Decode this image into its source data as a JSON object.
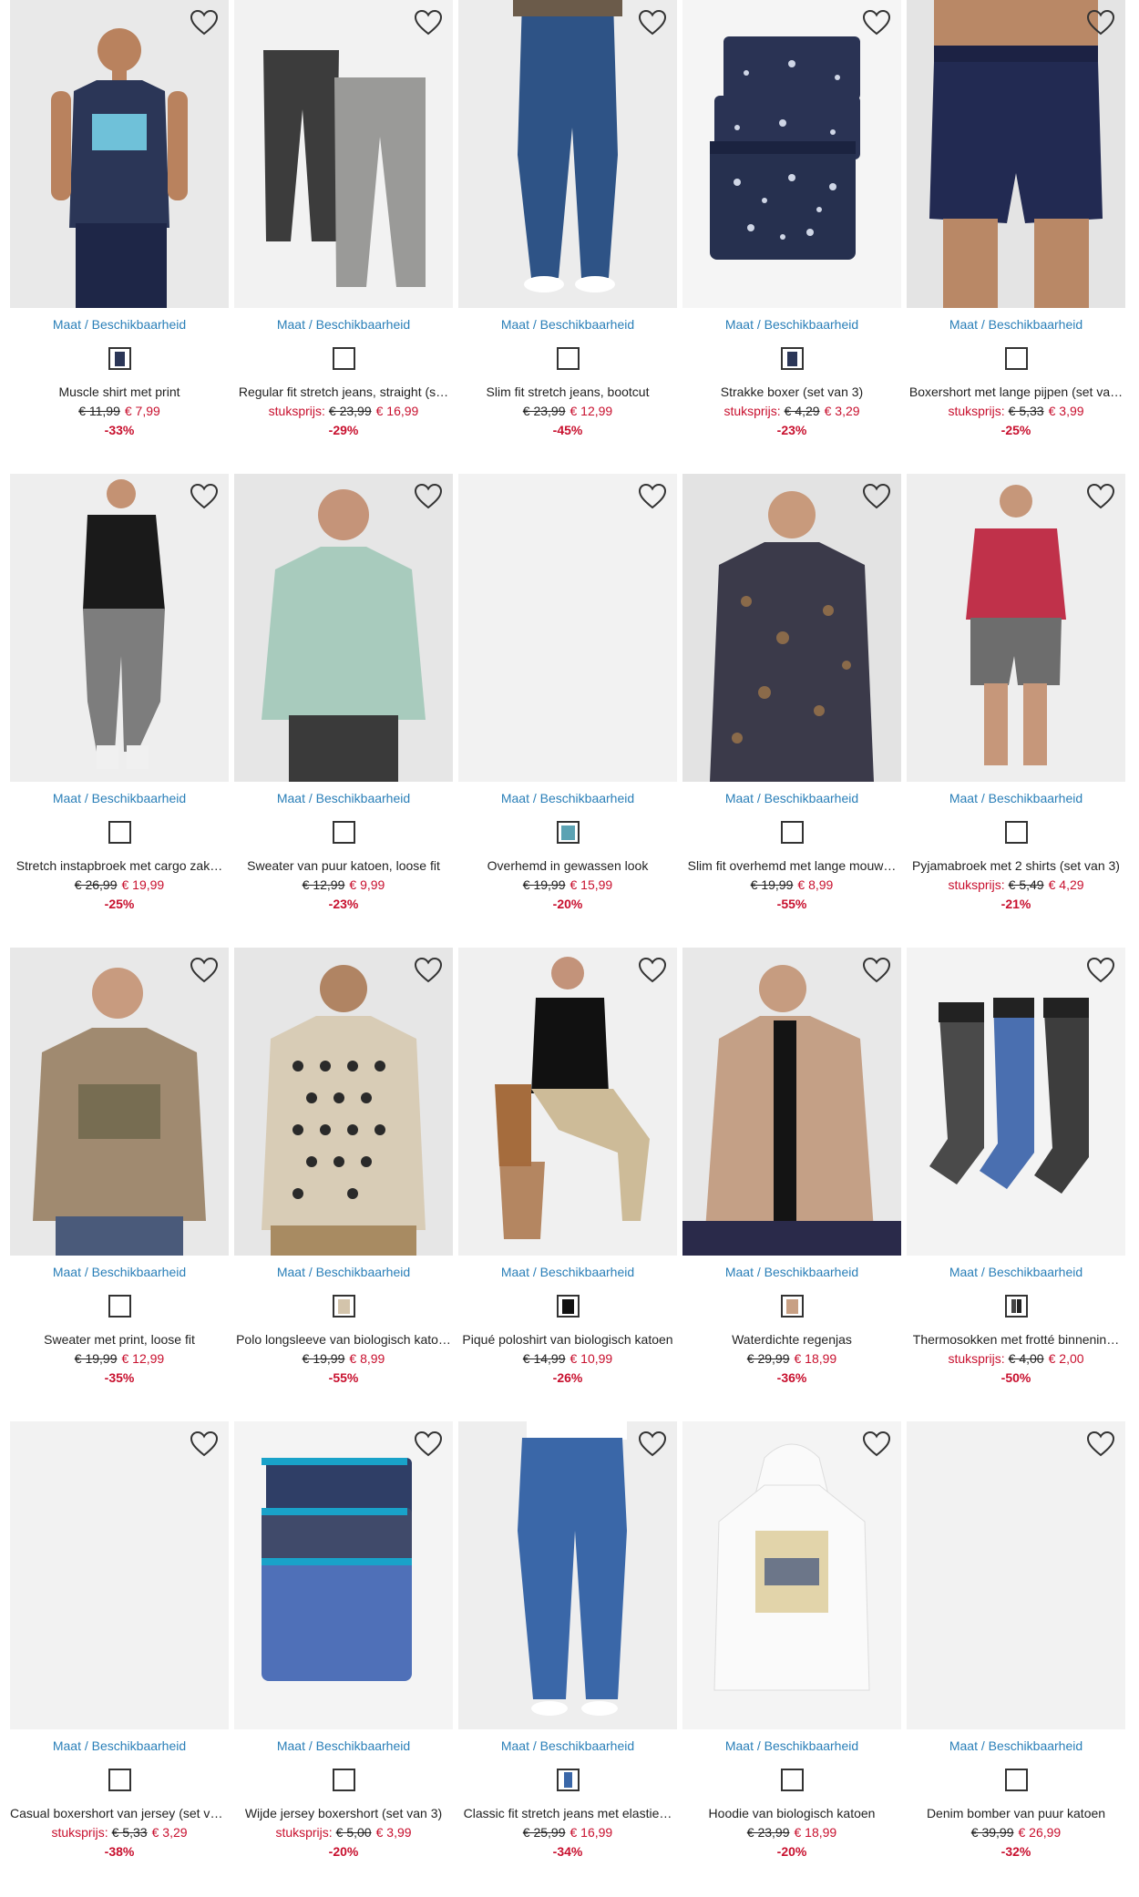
{
  "ui": {
    "size_label": "Maat / Beschikbaarheid",
    "unit_label": "stuksprijs:",
    "accent": "#2a7fb8",
    "sale": "#c8102e"
  },
  "products": [
    {
      "name": "Muscle shirt met print",
      "unit": false,
      "old": "€ 11,99",
      "new": "€ 7,99",
      "discount": "-33%",
      "art": "tank",
      "swatch": "navy"
    },
    {
      "name": "Regular fit stretch jeans, straight (s…",
      "unit": true,
      "old": "€ 23,99",
      "new": "€ 16,99",
      "discount": "-29%",
      "art": "jeans2",
      "swatch": "none"
    },
    {
      "name": "Slim fit stretch jeans, bootcut",
      "unit": false,
      "old": "€ 23,99",
      "new": "€ 12,99",
      "discount": "-45%",
      "art": "jeans",
      "swatch": "none"
    },
    {
      "name": "Strakke boxer (set van 3)",
      "unit": true,
      "old": "€ 4,29",
      "new": "€ 3,29",
      "discount": "-23%",
      "art": "boxers",
      "swatch": "navy"
    },
    {
      "name": "Boxershort met lange pijpen (set va…",
      "unit": true,
      "old": "€ 5,33",
      "new": "€ 3,99",
      "discount": "-25%",
      "art": "longboxer",
      "swatch": "none"
    },
    {
      "name": "Stretch instapbroek met cargo zak…",
      "unit": false,
      "old": "€ 26,99",
      "new": "€ 19,99",
      "discount": "-25%",
      "art": "cargo",
      "swatch": "none"
    },
    {
      "name": "Sweater van puur katoen, loose fit",
      "unit": false,
      "old": "€ 12,99",
      "new": "€ 9,99",
      "discount": "-23%",
      "art": "sweater",
      "swatch": "none"
    },
    {
      "name": "Overhemd in gewassen look",
      "unit": false,
      "old": "€ 19,99",
      "new": "€ 15,99",
      "discount": "-20%",
      "art": "blank",
      "swatch": "teal"
    },
    {
      "name": "Slim fit overhemd met lange mouw…",
      "unit": false,
      "old": "€ 19,99",
      "new": "€ 8,99",
      "discount": "-55%",
      "art": "shirt",
      "swatch": "none"
    },
    {
      "name": "Pyjamabroek met 2 shirts (set van 3)",
      "unit": true,
      "old": "€ 5,49",
      "new": "€ 4,29",
      "discount": "-21%",
      "art": "pyjama",
      "swatch": "none"
    },
    {
      "name": "Sweater met print, loose fit",
      "unit": false,
      "old": "€ 19,99",
      "new": "€ 12,99",
      "discount": "-35%",
      "art": "brownsweater",
      "swatch": "none"
    },
    {
      "name": "Polo longsleeve van biologisch kato…",
      "unit": false,
      "old": "€ 19,99",
      "new": "€ 8,99",
      "discount": "-55%",
      "art": "patternback",
      "swatch": "beige"
    },
    {
      "name": "Piqué poloshirt van biologisch katoen",
      "unit": false,
      "old": "€ 14,99",
      "new": "€ 10,99",
      "discount": "-26%",
      "art": "chair",
      "swatch": "black"
    },
    {
      "name": "Waterdichte regenjas",
      "unit": false,
      "old": "€ 29,99",
      "new": "€ 18,99",
      "discount": "-36%",
      "art": "jacket",
      "swatch": "tan"
    },
    {
      "name": "Thermosokken met frotté binnenin…",
      "unit": true,
      "old": "€ 4,00",
      "new": "€ 2,00",
      "discount": "-50%",
      "art": "socks",
      "swatch": "grey"
    },
    {
      "name": "Casual boxershort van jersey (set va…",
      "unit": true,
      "old": "€ 5,33",
      "new": "€ 3,29",
      "discount": "-38%",
      "art": "blank",
      "swatch": "none"
    },
    {
      "name": "Wijde jersey boxershort (set van 3)",
      "unit": true,
      "old": "€ 5,00",
      "new": "€ 3,99",
      "discount": "-20%",
      "art": "wideboxers",
      "swatch": "none"
    },
    {
      "name": "Classic fit stretch jeans met elastie…",
      "unit": false,
      "old": "€ 25,99",
      "new": "€ 16,99",
      "discount": "-34%",
      "art": "classicjeans",
      "swatch": "blue"
    },
    {
      "name": "Hoodie van biologisch katoen",
      "unit": false,
      "old": "€ 23,99",
      "new": "€ 18,99",
      "discount": "-20%",
      "art": "hoodie",
      "swatch": "none"
    },
    {
      "name": "Denim bomber van puur katoen",
      "unit": false,
      "old": "€ 39,99",
      "new": "€ 26,99",
      "discount": "-32%",
      "art": "blank",
      "swatch": "none"
    }
  ]
}
